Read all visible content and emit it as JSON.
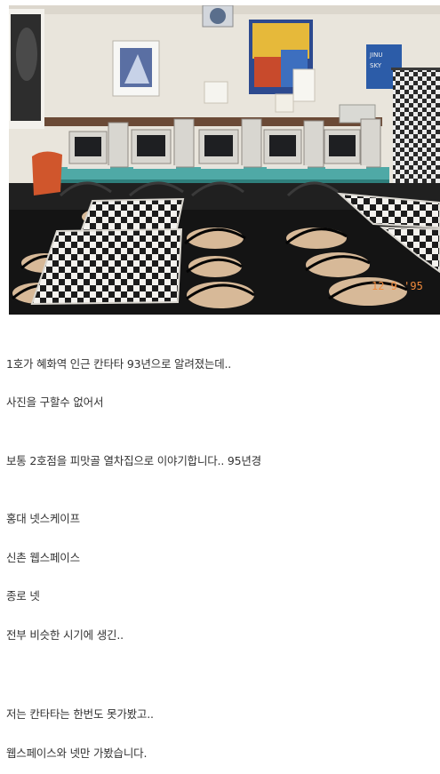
{
  "photo": {
    "date_stamp": "12 9 '95",
    "poster_lines": [
      "JINU",
      "SKY"
    ]
  },
  "lines": [
    "1호가 혜화역 인근 칸타타 93년으로 알려졌는데..",
    "사진을 구할수 없어서",
    "보통 2호점을 피맛골 열차집으로 이야기합니다.. 95년경",
    "홍대 넷스케이프",
    "신촌 웹스페이스",
    "종로 넷",
    "전부 비슷한 시기에 생긴..",
    "저는 칸타타는 한번도 못가봤고..",
    "웹스페이스와 넷만 가봤습니다."
  ]
}
